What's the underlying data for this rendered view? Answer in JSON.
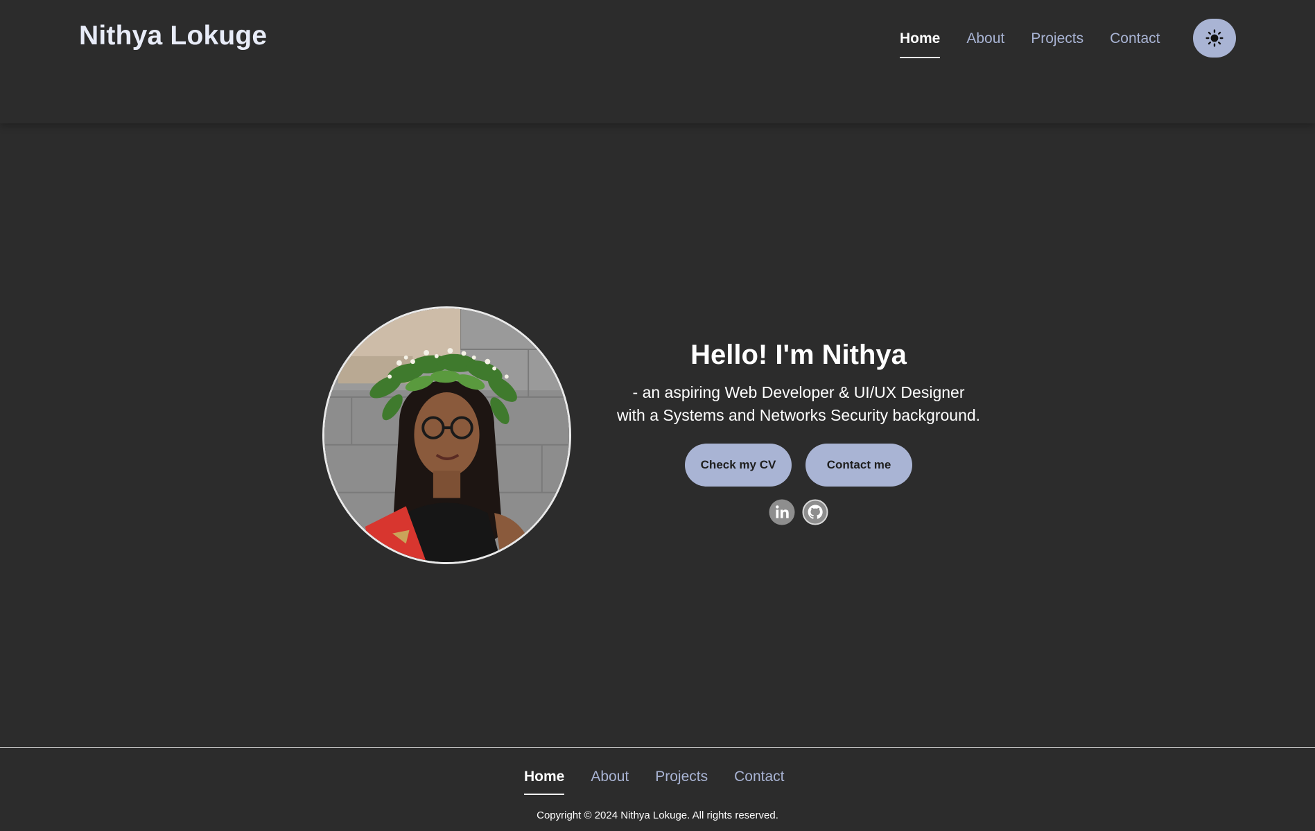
{
  "header": {
    "brand": "Nithya Lokuge",
    "nav": [
      {
        "label": "Home",
        "active": true
      },
      {
        "label": "About",
        "active": false
      },
      {
        "label": "Projects",
        "active": false
      },
      {
        "label": "Contact",
        "active": false
      }
    ],
    "theme_toggle_icon": "sun-icon"
  },
  "hero": {
    "title": "Hello! I'm Nithya",
    "subtitle_line1": "- an aspiring Web Developer & UI/UX Designer",
    "subtitle_line2": "with a Systems and Networks Security background.",
    "cv_button": "Check my CV",
    "contact_button": "Contact me",
    "social_icons": [
      "linkedin-icon",
      "github-icon"
    ]
  },
  "footer": {
    "nav": [
      {
        "label": "Home",
        "active": true
      },
      {
        "label": "About",
        "active": false
      },
      {
        "label": "Projects",
        "active": false
      },
      {
        "label": "Contact",
        "active": false
      }
    ],
    "copyright": "Copyright © 2024 Nithya Lokuge. All rights reserved."
  },
  "colors": {
    "background": "#2c2c2c",
    "accent": "#a9b4d4",
    "brand_text": "#e8ecf8"
  }
}
